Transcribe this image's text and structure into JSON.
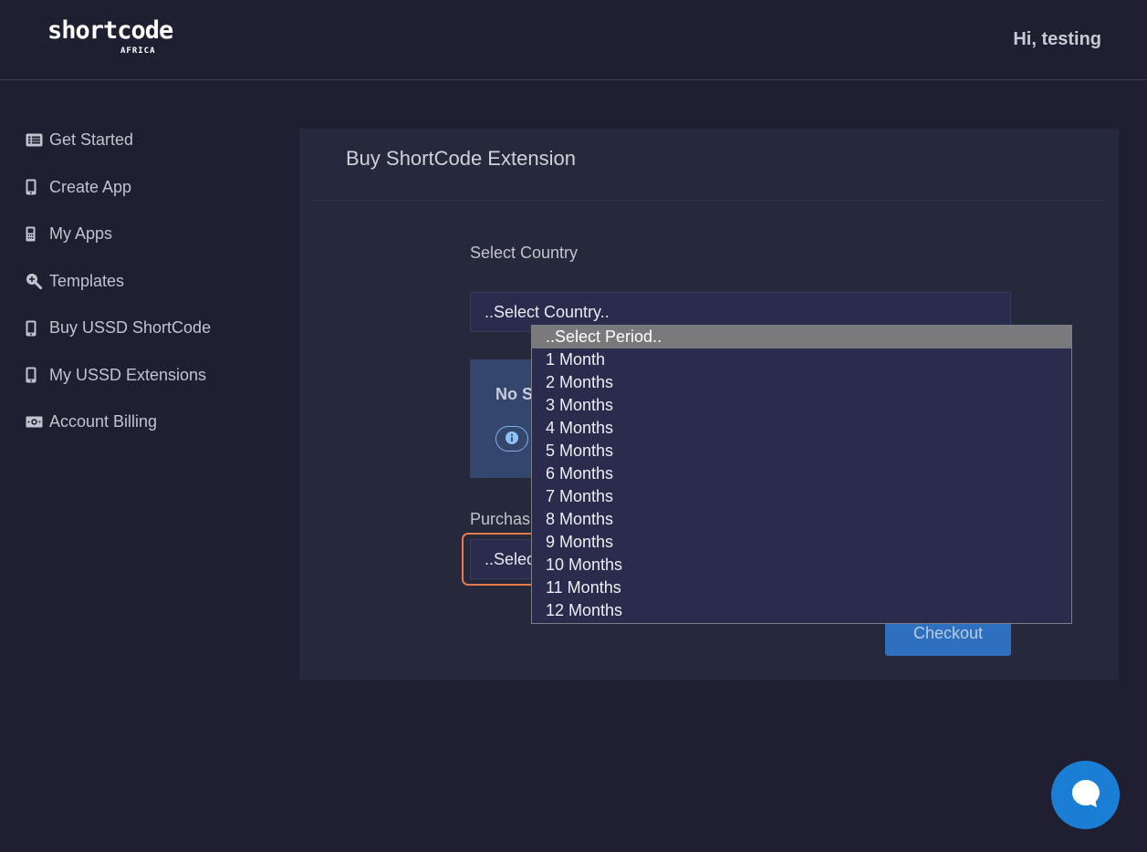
{
  "header": {
    "logo_main": "shortcode",
    "logo_sub": "AFRICA",
    "greeting": "Hi, testing"
  },
  "sidebar": {
    "items": [
      {
        "label": "Get Started",
        "icon": "list-icon"
      },
      {
        "label": "Create App",
        "icon": "mobile-icon"
      },
      {
        "label": "My Apps",
        "icon": "mobile-alt-icon"
      },
      {
        "label": "Templates",
        "icon": "search-plus-icon"
      },
      {
        "label": "Buy USSD ShortCode",
        "icon": "mobile-icon"
      },
      {
        "label": "My USSD Extensions",
        "icon": "mobile-icon"
      },
      {
        "label": "Account Billing",
        "icon": "money-bill-icon"
      }
    ]
  },
  "main": {
    "title": "Buy ShortCode Extension",
    "country_label": "Select Country",
    "country_select_value": "..Select Country..",
    "info_title": "No S",
    "purchase_label": "Purchas",
    "period_select_value": "..Selec",
    "checkout_label": "Checkout"
  },
  "dropdown": {
    "options": [
      "..Select Period..",
      "1 Month",
      "2 Months",
      "3 Months",
      "4 Months",
      "5 Months",
      "6 Months",
      "7 Months",
      "8 Months",
      "9 Months",
      "10 Months",
      "11 Months",
      "12 Months"
    ],
    "selected_index": 0
  },
  "colors": {
    "background": "#1f1f31",
    "card": "#26283b",
    "accent": "#2e6fbf",
    "focus": "#e87b4d",
    "chat": "#1a7fd4"
  }
}
